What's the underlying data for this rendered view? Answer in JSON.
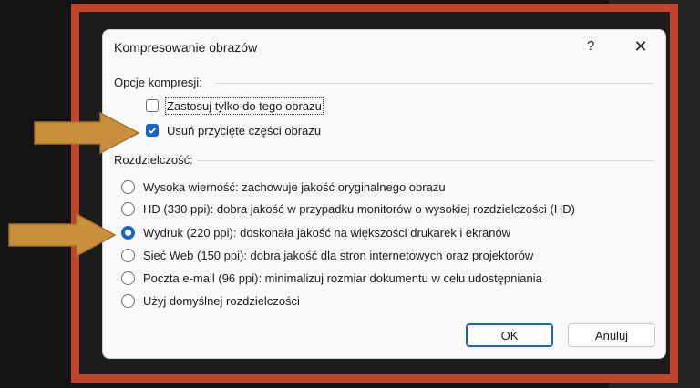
{
  "dialog": {
    "title": "Kompresowanie obrazów",
    "help_label": "?",
    "close_label": "✕"
  },
  "compression": {
    "label": "Opcje kompresji:",
    "options": [
      {
        "label": "Zastosuj tylko do tego obrazu",
        "checked": false
      },
      {
        "label": "Usuń przycięte części obrazu",
        "checked": true
      }
    ]
  },
  "resolution": {
    "label": "Rozdzielczość:",
    "options": [
      {
        "label": "Wysoka wierność: zachowuje jakość oryginalnego obrazu",
        "selected": false
      },
      {
        "label": "HD (330 ppi): dobra jakość w przypadku monitorów o wysokiej rozdzielczości (HD)",
        "selected": false
      },
      {
        "label": "Wydruk (220 ppi): doskonała jakość na większości drukarek i ekranów",
        "selected": true
      },
      {
        "label": "Sieć Web (150 ppi): dobra jakość dla stron internetowych oraz projektorów",
        "selected": false
      },
      {
        "label": "Poczta e-mail (96 ppi): minimalizuj rozmiar dokumentu w celu udostępniania",
        "selected": false
      },
      {
        "label": "Użyj domyślnej rozdzielczości",
        "selected": false
      }
    ]
  },
  "buttons": {
    "ok": "OK",
    "cancel": "Anuluj"
  },
  "colors": {
    "highlight_frame": "#c0442a",
    "arrow": "#c8903c",
    "accent": "#1a63c6"
  }
}
